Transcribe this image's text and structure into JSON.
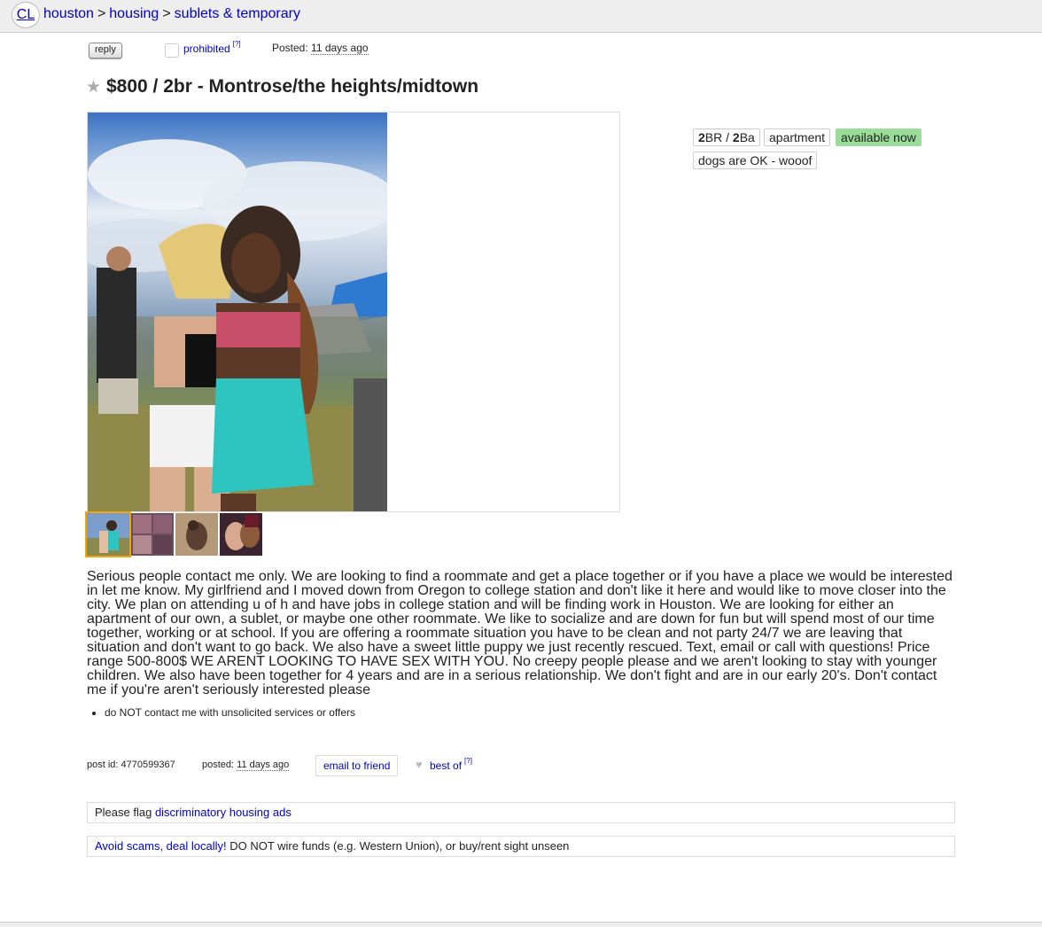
{
  "nav": {
    "logo": "CL",
    "crumbs": [
      "houston",
      "housing",
      "sublets & temporary"
    ],
    "sep": ">"
  },
  "actions": {
    "reply_label": "reply",
    "prohibited_label": "prohibited",
    "help_mark": "[?]",
    "posted_label": "Posted:",
    "posted_value": "11 days ago"
  },
  "posting": {
    "title": "$800 / 2br - Montrose/the heights/midtown"
  },
  "attributes": {
    "br_num": "2",
    "br_label": "BR / ",
    "ba_num": "2",
    "ba_label": "Ba",
    "housing_type": "apartment",
    "availability": "available now",
    "pets": "dogs are OK - wooof"
  },
  "body": "Serious people contact me only. We are looking to find a roommate and get a place together or if you have a place we would be interested in let me know. My girlfriend and I moved down from Oregon to college station and don't like it here and would like to move closer into the city. We plan on attending u of h and have jobs in college station and will be finding work in Houston. We are looking for either an apartment of our own, a sublet, or maybe one other roommate. We like to socialize and are down for fun but will spend most of our time together, working or at school. If you are offering a roommate situation you have to be clean and not party 24/7 we are leaving that situation and don't want to go back. We also have a sweet little puppy we just recently rescued. Text, email or call with questions! Price range 500-800$ WE ARENT LOOKING TO HAVE SEX WITH YOU. No creepy people please and we aren't looking to stay with younger children. We also have been together for 4 years and are in a serious relationship. We don't fight and are in our early 20's. Don't contact me if you're aren't seriously interested please",
  "notices": [
    "do NOT contact me with unsolicited services or offers"
  ],
  "postinfo": {
    "post_id_label": "post id:",
    "post_id": "4770599367",
    "posted_label": "posted:",
    "posted_value": "11 days ago",
    "email_label": "email to friend",
    "bestof_label": "best of",
    "help_mark": "[?]"
  },
  "flag": {
    "prefix": "Please flag ",
    "link": "discriminatory housing ads"
  },
  "scam": {
    "link": "Avoid scams, deal locally!",
    "text": " DO NOT wire funds (e.g. Western Union), or buy/rent sight unseen"
  }
}
